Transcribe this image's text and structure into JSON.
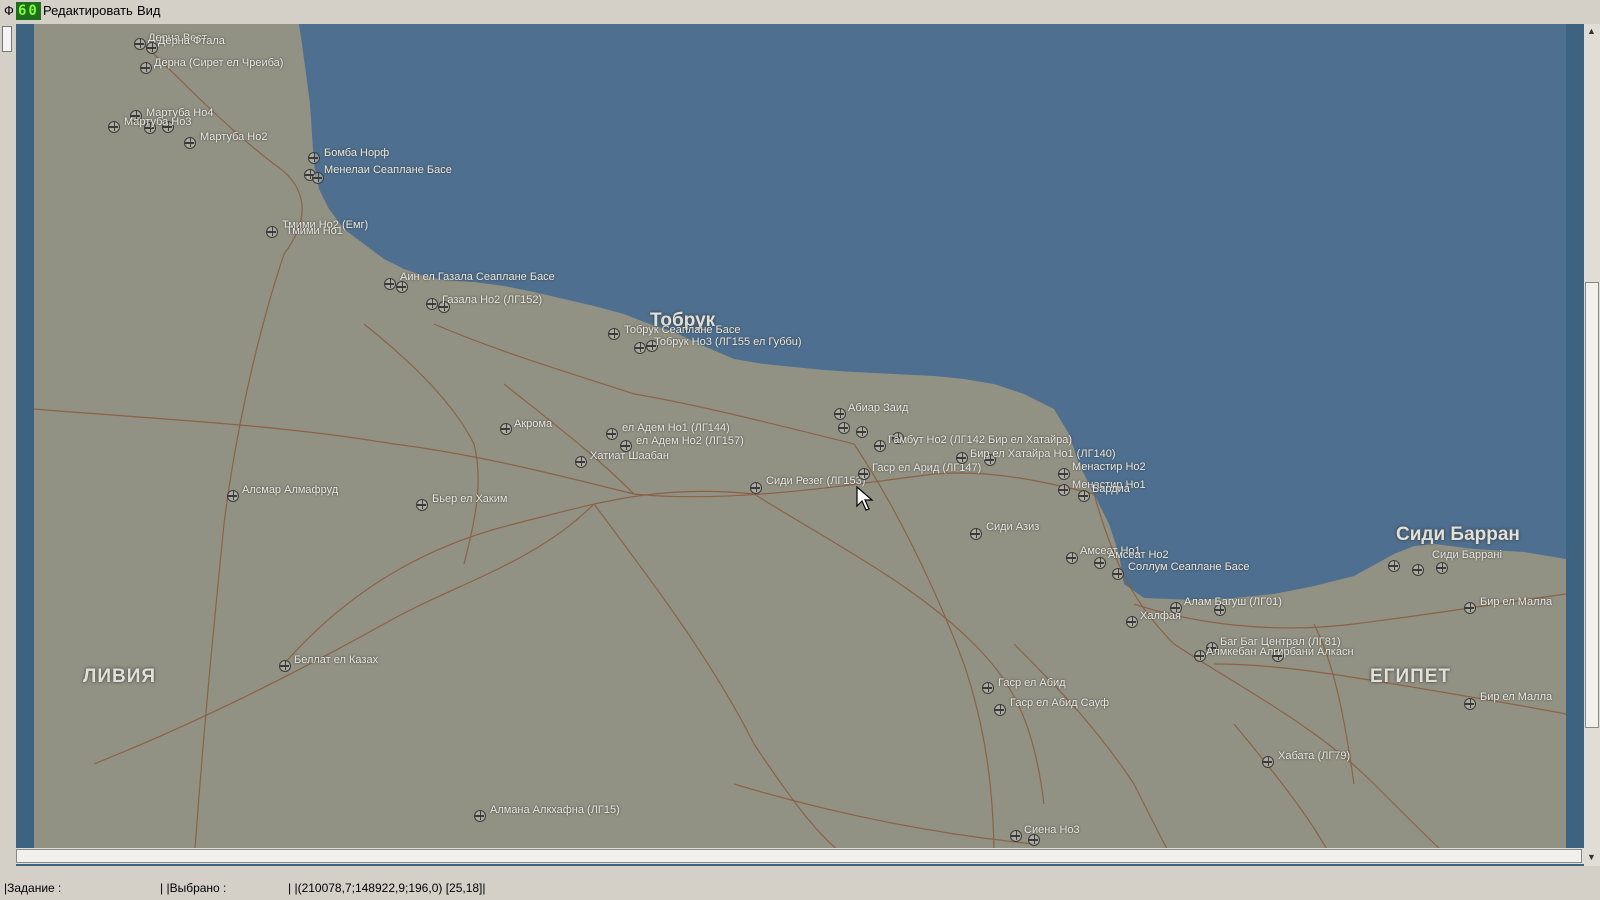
{
  "menu": {
    "file_label": "Ф",
    "edit_label": "Редактировать",
    "view_label": "Вид",
    "fps_value": "60"
  },
  "map": {
    "countries": [
      "ЛИВИЯ",
      "ЕГИПЕТ"
    ],
    "cities": [
      "Тобрук",
      "Сиди Барран"
    ],
    "airfields": [
      "Дерна Вест",
      "Дерна Фтала",
      "Дерна (Сирет ел Чреиба)",
      "Мартуба Но4",
      "Мартуба Но3",
      "Мартуба Но2",
      "Бомба Норф",
      "Менелаи Сеаплане Басе",
      "Тмими Но2 (Емг)",
      "Тмими Но1",
      "Аин ел Газала Сеаплане Басе",
      "Газала Но2 (ЛГ152)",
      "Тобрук Сеаплане Басе",
      "Тобрук Но3 (ЛГ155 ел Губбu)",
      "Акрома",
      "ел Адем Но1 (ЛГ144)",
      "ел Адем Но2 (ЛГ157)",
      "Хатиат Шаабан",
      "Алсмар Алмафруд",
      "Бьер ел Хаким",
      "Сиди Резег (ЛГ153)",
      "Абиар Заид",
      "Гамбут Но2 (ЛГ142 Бир ел Хатайра)",
      "Гаср ел Арид (ЛГ147)",
      "Бир ел Хатайра Но1 (ЛГ140)",
      "Менастир Но2",
      "Менастир Но1",
      "Бардиа",
      "Сиди Азиз",
      "Амсеат Но1",
      "Амсеат Но2",
      "Соллум Сеаплане Басе",
      "Алам Багуш (ЛГ01)",
      "Халфая",
      "Баг Баг Централ (ЛГ81)",
      "Алмкебан Алгирбани Алкасн",
      "Сиди Барранi",
      "Бир ел Малла",
      "Бир ел Малла",
      "Беллат ел Казах",
      "Гаср ел Абид",
      "Гаср ел Абид Сауф",
      "Хабата (ЛГ79)",
      "Алмана Алкхафна (ЛГ15)",
      "Сиена Но3"
    ]
  },
  "status": {
    "task_label": "|Задание :",
    "selected_label": "| |Выбрано :",
    "coords": "| |(210078,7;148922,9;196,0) [25,18]|"
  },
  "colors": {
    "sea": "#4e6f8f",
    "land": "#919184",
    "roads": "#8a5a3c",
    "frame": "#3e6381"
  },
  "icons": [
    "airfield-icon",
    "mouse-cursor-icon"
  ]
}
